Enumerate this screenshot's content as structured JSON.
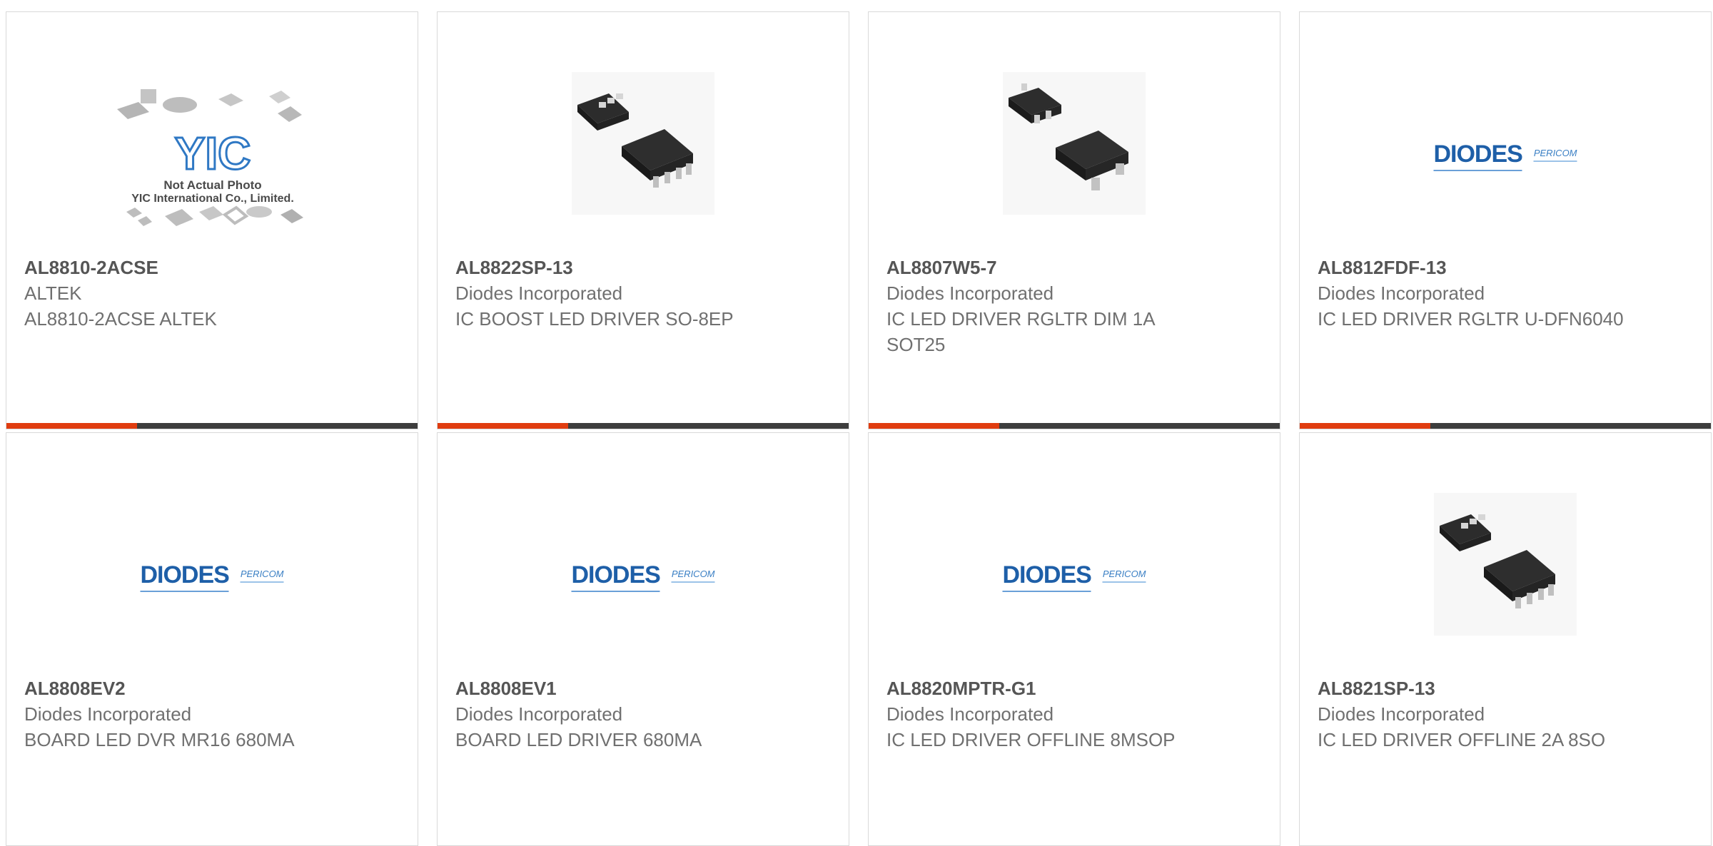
{
  "colors": {
    "accent": "#e03c10",
    "bar": "#3d3d3d",
    "brand_blue": "#1e5fa8"
  },
  "placeholder": {
    "line1": "Not Actual Photo",
    "line2": "YIC International Co., Limited.",
    "logo": "YIC"
  },
  "brand_logo": {
    "name": "DIODES",
    "sub": "PERICOM"
  },
  "products": [
    {
      "part": "AL8810-2ACSE",
      "manufacturer": "ALTEK",
      "description": "AL8810-2ACSE ALTEK",
      "image": "placeholder"
    },
    {
      "part": "AL8822SP-13",
      "manufacturer": "Diodes Incorporated",
      "description": "IC BOOST LED DRIVER SO-8EP",
      "image": "so8-chips"
    },
    {
      "part": "AL8807W5-7",
      "manufacturer": "Diodes Incorporated",
      "description": "IC LED DRIVER RGLTR DIM 1A SOT25",
      "image": "sot25-chips"
    },
    {
      "part": "AL8812FDF-13",
      "manufacturer": "Diodes Incorporated",
      "description": "IC LED DRIVER RGLTR U-DFN6040",
      "image": "diodes-logo"
    },
    {
      "part": "AL8808EV2",
      "manufacturer": "Diodes Incorporated",
      "description": "BOARD LED DVR MR16 680MA",
      "image": "diodes-logo"
    },
    {
      "part": "AL8808EV1",
      "manufacturer": "Diodes Incorporated",
      "description": "BOARD LED DRIVER 680MA",
      "image": "diodes-logo"
    },
    {
      "part": "AL8820MPTR-G1",
      "manufacturer": "Diodes Incorporated",
      "description": "IC LED DRIVER OFFLINE 8MSOP",
      "image": "diodes-logo"
    },
    {
      "part": "AL8821SP-13",
      "manufacturer": "Diodes Incorporated",
      "description": "IC LED DRIVER OFFLINE 2A 8SO",
      "image": "so8-chips"
    }
  ]
}
